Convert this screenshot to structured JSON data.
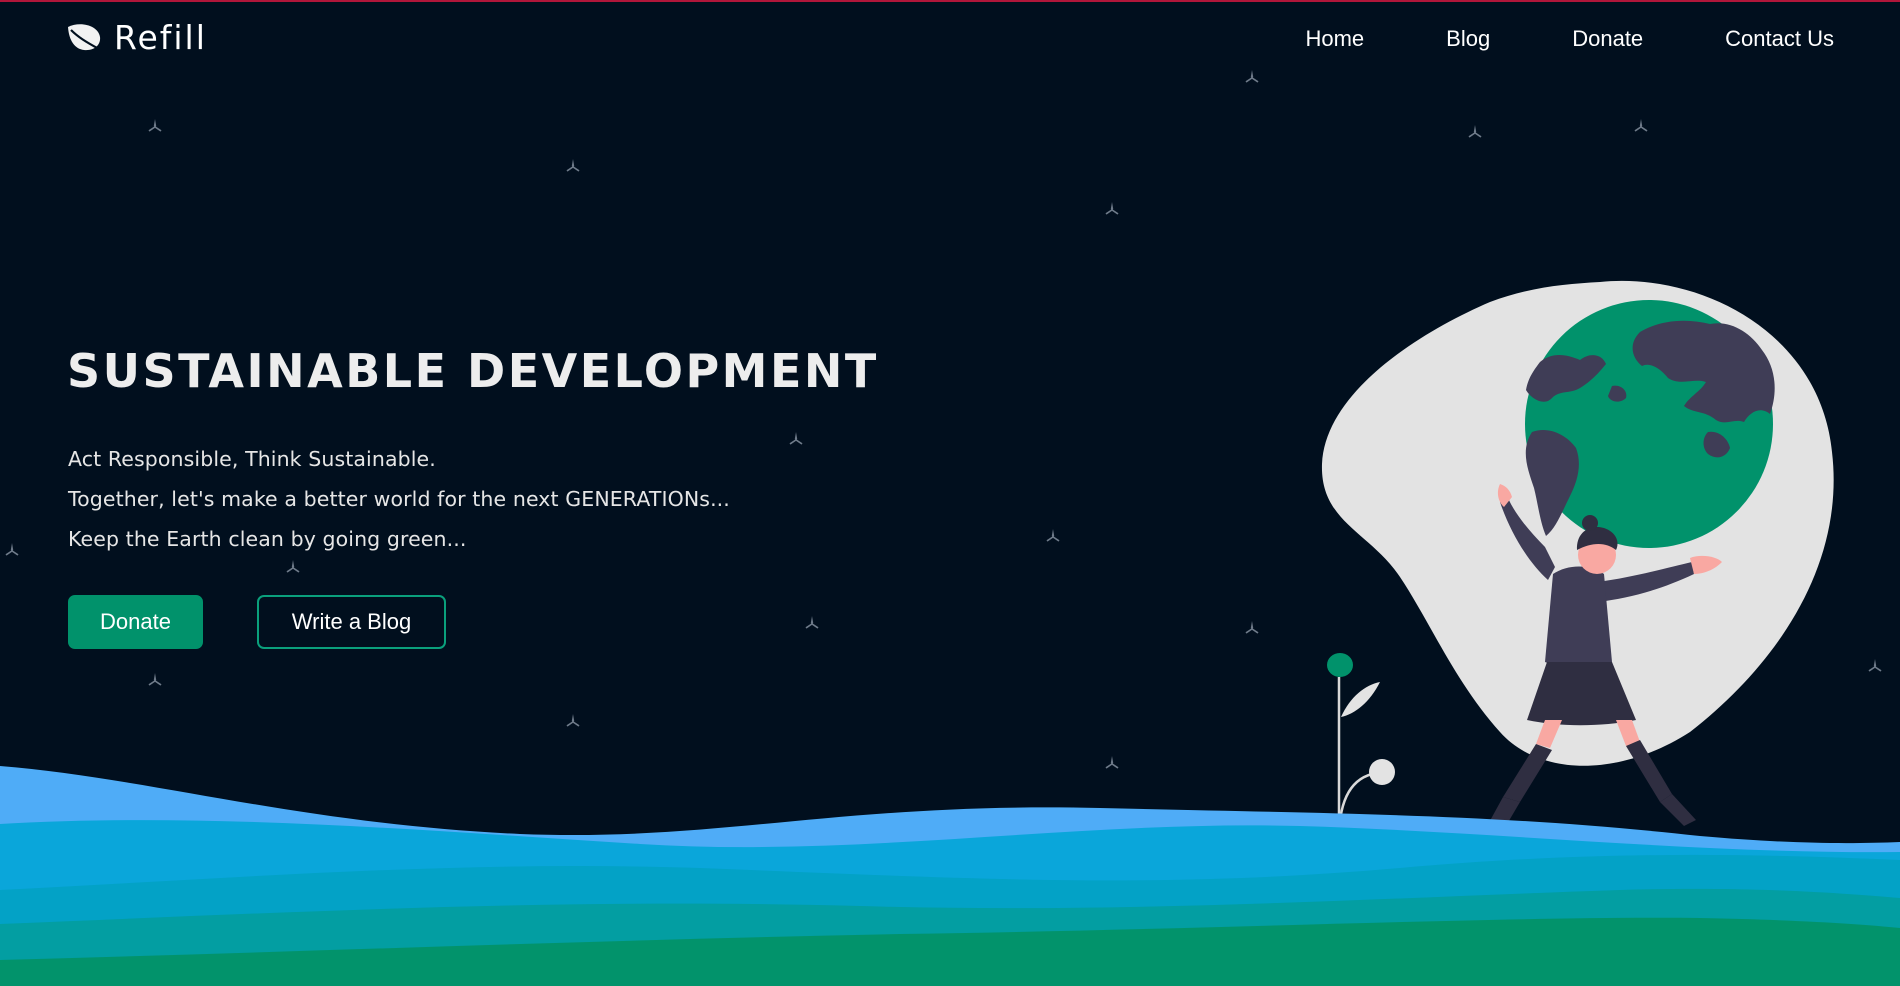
{
  "brand": {
    "name": "Refill",
    "logo_icon": "leaf-icon"
  },
  "nav": {
    "items": [
      {
        "label": "Home"
      },
      {
        "label": "Blog"
      },
      {
        "label": "Donate"
      },
      {
        "label": "Contact Us"
      }
    ]
  },
  "hero": {
    "title": "SUSTAINABLE DEVELOPMENT",
    "lines": [
      "Act Responsible, Think Sustainable.",
      "Together, let's make a better world for the next GENERATIONs...",
      "Keep the Earth clean by going green..."
    ],
    "primary_button": "Donate",
    "secondary_button": "Write a Blog"
  },
  "colors": {
    "background": "#010f1e",
    "accent": "#01926b",
    "top_border": "#b0163a",
    "wave_light": "#4facf7",
    "wave_mid": "#0aa6da",
    "wave_teal": "#03a6b5",
    "wave_green": "#02936b"
  }
}
